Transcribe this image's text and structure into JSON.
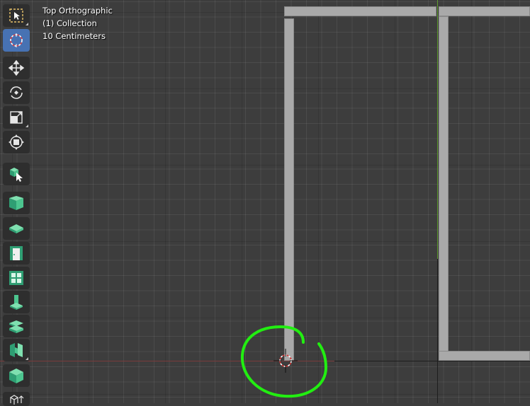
{
  "viewport": {
    "view_name": "Top Orthographic",
    "collection": "(1) Collection",
    "scale": "10 Centimeters"
  },
  "colors": {
    "background": "#3d3d3d",
    "x_axis": "#7a3a3a",
    "y_axis": "#5d9a2e",
    "active_tool": "#4772b3",
    "annotation": "#22ee11",
    "wall": "#a9a9a9"
  },
  "toolbar": {
    "tools": [
      {
        "icon": "select-box-icon",
        "active": false
      },
      {
        "icon": "cursor-icon",
        "active": true
      },
      {
        "icon": "move-icon",
        "active": false
      },
      {
        "icon": "rotate-icon",
        "active": false
      },
      {
        "icon": "scale-icon",
        "active": false
      },
      {
        "icon": "transform-icon",
        "active": false
      },
      {
        "icon": "bim-select-icon",
        "active": false
      },
      {
        "icon": "wall-icon",
        "active": false
      },
      {
        "icon": "slab-icon",
        "active": false
      },
      {
        "icon": "door-icon",
        "active": false
      },
      {
        "icon": "window-icon",
        "active": false
      },
      {
        "icon": "column-icon",
        "active": false
      },
      {
        "icon": "stair-icon",
        "active": false
      },
      {
        "icon": "beam-icon",
        "active": false
      },
      {
        "icon": "object-icon",
        "active": false
      },
      {
        "icon": "more-icon",
        "active": false
      }
    ]
  }
}
